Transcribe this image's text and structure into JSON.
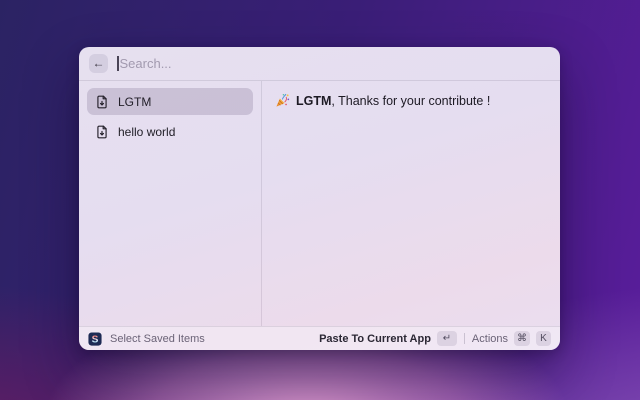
{
  "window": {
    "header": {
      "back_icon": "←",
      "search_placeholder": "Search..."
    },
    "sidebar": {
      "items": [
        {
          "label": "LGTM",
          "selected": true,
          "icon": "file-down-icon"
        },
        {
          "label": "hello world",
          "selected": false,
          "icon": "file-down-icon"
        }
      ]
    },
    "preview": {
      "emoji": "🎉",
      "bold_text": "LGTM",
      "rest_text": ", Thanks for your contribute !"
    },
    "footer": {
      "app_icon": "s-app-icon",
      "app_label": "Select Saved Items",
      "primary_action": "Paste To Current App",
      "primary_key": "↵",
      "separator": "|",
      "secondary_action": "Actions",
      "secondary_keys": [
        "⌘",
        "K"
      ]
    }
  },
  "colors": {
    "wallpaper_indigo": "#2b2363",
    "wallpaper_purple": "#5a1d9c",
    "wallpaper_magenta": "#6d1b62",
    "wallpaper_pink_glow": "#eca6d6",
    "window_tint": "#e6e0ef",
    "selected_item_highlight": "#c9c1d4"
  }
}
